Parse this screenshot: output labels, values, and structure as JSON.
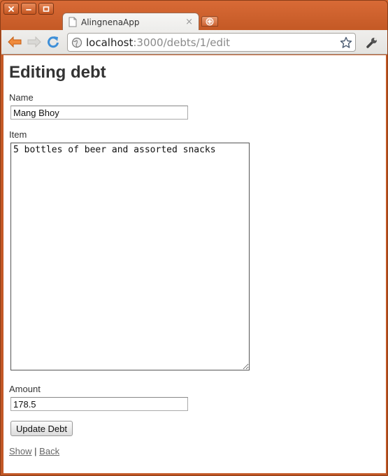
{
  "browser": {
    "tab": {
      "title": "AlingnenaApp",
      "close_glyph": "×"
    },
    "url": {
      "host": "localhost",
      "path": ":3000/debts/1/edit"
    },
    "icons": [
      "back-arrow-icon",
      "forward-arrow-icon",
      "reload-icon",
      "globe-icon",
      "star-icon",
      "wrench-icon",
      "new-tab-icon",
      "close-window-icon",
      "minimize-icon",
      "maximize-icon"
    ],
    "accent_color": "#d7662f"
  },
  "page": {
    "title": "Editing debt",
    "name": {
      "label": "Name",
      "value": "Mang Bhoy"
    },
    "item": {
      "label": "Item",
      "value": "5 bottles of beer and assorted snacks"
    },
    "amount": {
      "label": "Amount",
      "value": "178.5"
    },
    "submit_label": "Update Debt",
    "links": {
      "show": "Show",
      "separator": "|",
      "back": "Back"
    }
  }
}
